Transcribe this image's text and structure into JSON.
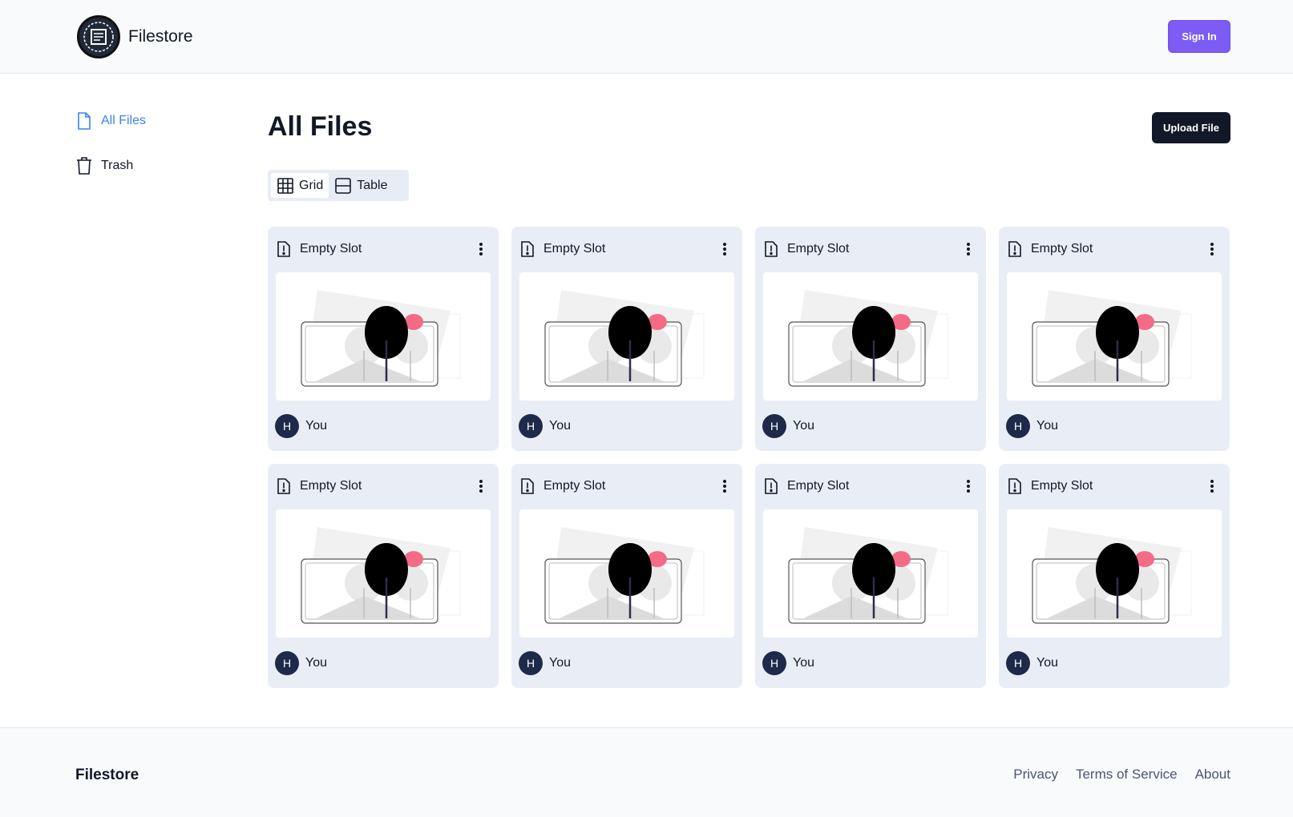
{
  "header": {
    "brand": "Filestore",
    "sign_in": "Sign In"
  },
  "sidebar": {
    "items": [
      {
        "label": "All Files",
        "icon": "file-icon",
        "active": true
      },
      {
        "label": "Trash",
        "icon": "trash-icon",
        "active": false
      }
    ]
  },
  "main": {
    "title": "All Files",
    "upload_label": "Upload File",
    "view_toggle": [
      {
        "label": "Grid",
        "icon": "grid-icon",
        "selected": true
      },
      {
        "label": "Table",
        "icon": "table-icon",
        "selected": false
      }
    ],
    "cards": [
      {
        "title": "Empty Slot",
        "avatar_initial": "H",
        "owner": "You"
      },
      {
        "title": "Empty Slot",
        "avatar_initial": "H",
        "owner": "You"
      },
      {
        "title": "Empty Slot",
        "avatar_initial": "H",
        "owner": "You"
      },
      {
        "title": "Empty Slot",
        "avatar_initial": "H",
        "owner": "You"
      },
      {
        "title": "Empty Slot",
        "avatar_initial": "H",
        "owner": "You"
      },
      {
        "title": "Empty Slot",
        "avatar_initial": "H",
        "owner": "You"
      },
      {
        "title": "Empty Slot",
        "avatar_initial": "H",
        "owner": "You"
      },
      {
        "title": "Empty Slot",
        "avatar_initial": "H",
        "owner": "You"
      }
    ]
  },
  "footer": {
    "brand": "Filestore",
    "links": [
      "Privacy",
      "Terms of Service",
      "About"
    ]
  },
  "colors": {
    "accent": "#7c5cf5",
    "active_nav": "#3b82f6",
    "dark_button": "#111827",
    "card_bg": "#e9eef6",
    "avatar_bg": "#1e2a4a"
  }
}
